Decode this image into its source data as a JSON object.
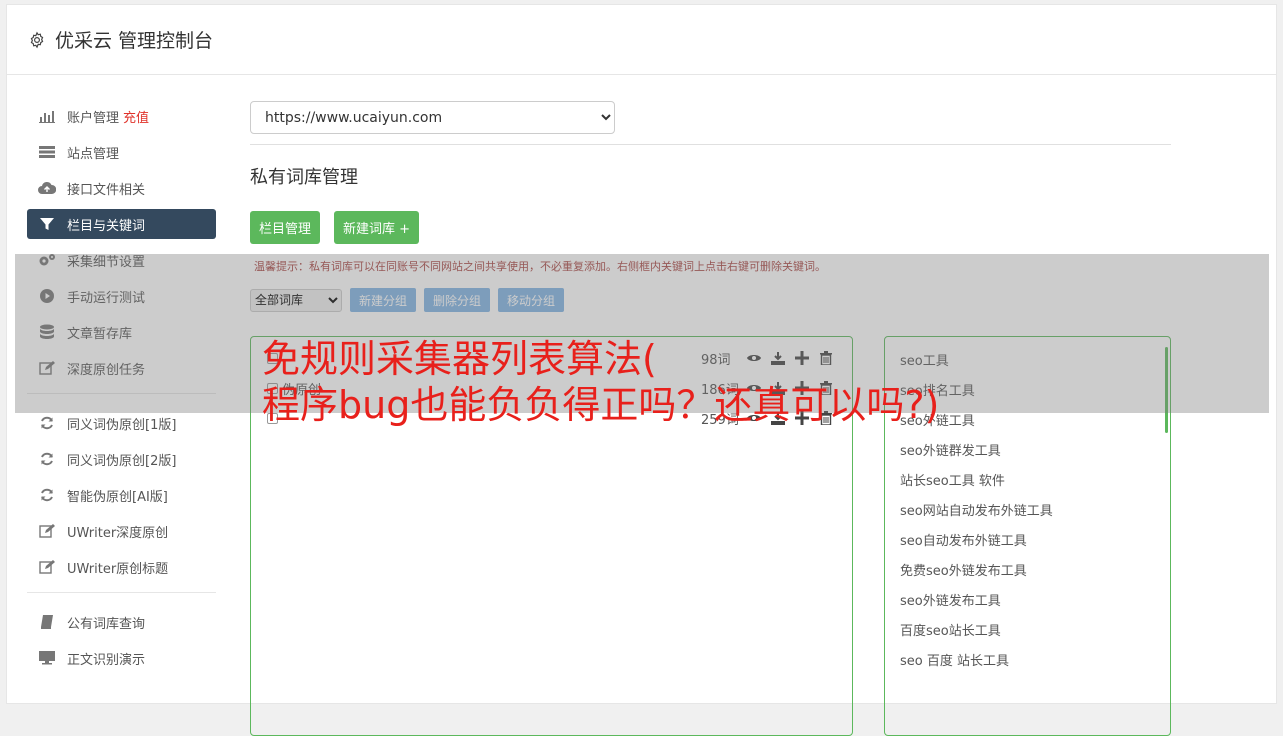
{
  "header": {
    "title": "优采云 管理控制台",
    "icon": "gear-icon"
  },
  "sidebar": {
    "group1": [
      {
        "label": "账户管理",
        "badge": "充值",
        "icon": "bar-chart-icon"
      },
      {
        "label": "站点管理",
        "icon": "server-icon"
      },
      {
        "label": "接口文件相关",
        "icon": "cloud-upload-icon"
      },
      {
        "label": "栏目与关键词",
        "icon": "filter-icon",
        "active": true
      },
      {
        "label": "采集细节设置",
        "icon": "gears-icon"
      },
      {
        "label": "手动运行测试",
        "icon": "play-circle-icon"
      },
      {
        "label": "文章暂存库",
        "icon": "database-icon"
      },
      {
        "label": "深度原创任务",
        "icon": "edit-icon"
      }
    ],
    "group2": [
      {
        "label": "同义词伪原创[1版]",
        "icon": "refresh-icon"
      },
      {
        "label": "同义词伪原创[2版]",
        "icon": "refresh-icon"
      },
      {
        "label": "智能伪原创[AI版]",
        "icon": "refresh-icon"
      },
      {
        "label": "UWriter深度原创",
        "icon": "edit-icon"
      },
      {
        "label": "UWriter原创标题",
        "icon": "edit-icon"
      }
    ],
    "group3": [
      {
        "label": "公有词库查询",
        "icon": "book-icon"
      },
      {
        "label": "正文识别演示",
        "icon": "monitor-icon"
      }
    ]
  },
  "main": {
    "site_select": {
      "value": "https://www.ucaiyun.com"
    },
    "section_title": "私有词库管理",
    "buttons": {
      "columns": "栏目管理",
      "new_lib": "新建词库 +"
    },
    "tip": "温馨提示：私有词库可以在同账号不同网站之间共享使用，不必重复添加。右侧框内关键词上点击右键可删除关键词。",
    "lib_filter": {
      "value": "全部词库"
    },
    "group_buttons": {
      "new_group": "新建分组",
      "delete_group": "删除分组",
      "move_group": "移动分组"
    },
    "libraries": [
      {
        "name": "",
        "count": "98词"
      },
      {
        "name": "伪原创",
        "count": "186词"
      },
      {
        "name": "",
        "count": "259词"
      }
    ],
    "keywords": [
      "seo工具",
      "seo排名工具",
      "seo外链工具",
      "seo外链群发工具",
      "站长seo工具 软件",
      "seo网站自动发布外链工具",
      "seo自动发布外链工具",
      "免费seo外链发布工具",
      "seo外链发布工具",
      "百度seo站长工具",
      "seo 百度 站长工具"
    ]
  },
  "overlay": {
    "line1": "免规则采集器列表算法(",
    "line2": "程序bug也能负负得正吗？还真可以吗?)"
  }
}
